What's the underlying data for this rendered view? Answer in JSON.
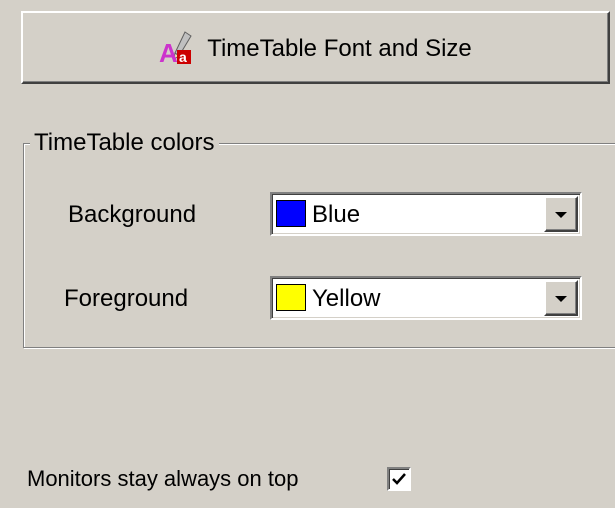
{
  "font_button": {
    "label": "TimeTable Font and Size",
    "icon": "font-size-icon"
  },
  "colors_group": {
    "title": "TimeTable colors",
    "background": {
      "label": "Background",
      "value": "Blue",
      "swatch_color": "#0000ff"
    },
    "foreground": {
      "label": "Foreground",
      "value": "Yellow",
      "swatch_color": "#ffff00"
    }
  },
  "monitors": {
    "label": "Monitors stay always on top",
    "checked": true
  }
}
